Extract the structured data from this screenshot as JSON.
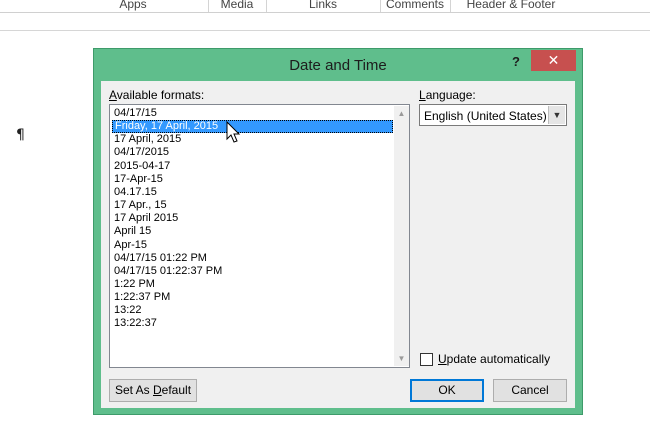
{
  "ribbon": {
    "groups": [
      "Apps",
      "Media",
      "Links",
      "Comments",
      "Header & Footer"
    ]
  },
  "document": {
    "paragraph_mark": "¶"
  },
  "dialog": {
    "title": "Date and Time",
    "help": "?",
    "close": "✕",
    "formats_label_hotkey": "A",
    "formats_label_rest": "vailable formats:",
    "formats": [
      "04/17/15",
      "Friday, 17 April, 2015",
      "17 April, 2015",
      "04/17/2015",
      "2015-04-17",
      "17-Apr-15",
      "04.17.15",
      "17 Apr., 15",
      "17 April 2015",
      "April 15",
      "Apr-15",
      "04/17/15 01:22 PM",
      "04/17/15 01:22:37 PM",
      "1:22 PM",
      "1:22:37 PM",
      "13:22",
      "13:22:37"
    ],
    "selected_format": "Friday, 17 April, 2015",
    "language_label_hotkey": "L",
    "language_label_rest": "anguage:",
    "language_value": "English (United States)",
    "update_pre": "",
    "update_hotkey": "U",
    "update_rest": "pdate automatically",
    "update_checked": false,
    "set_default_pre": "Set As ",
    "set_default_hotkey": "D",
    "set_default_rest": "efault",
    "ok_label": "OK",
    "cancel_label": "Cancel"
  },
  "colors": {
    "dialog_frame": "#5fbe8c",
    "close_button": "#c7504f",
    "selection": "#3399ff"
  }
}
